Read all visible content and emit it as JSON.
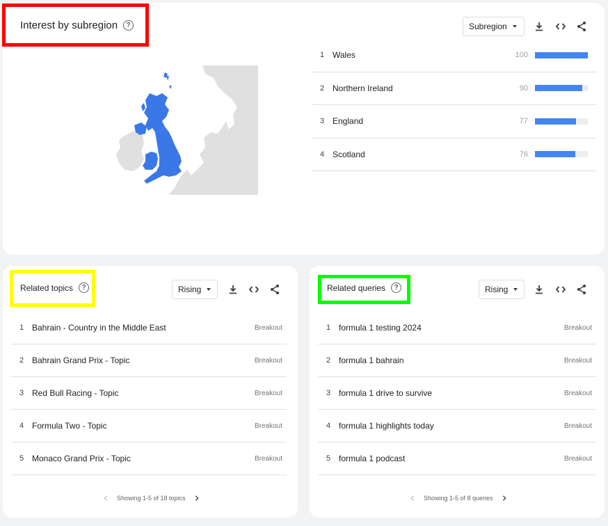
{
  "subregion": {
    "title": "Interest by subregion",
    "dropdown": "Subregion",
    "rows": [
      {
        "rank": "1",
        "name": "Wales",
        "value": "100",
        "fraction": 1.0
      },
      {
        "rank": "2",
        "name": "Northern Ireland",
        "value": "90",
        "fraction": 0.9
      },
      {
        "rank": "3",
        "name": "England",
        "value": "77",
        "fraction": 0.77
      },
      {
        "rank": "4",
        "name": "Scotland",
        "value": "76",
        "fraction": 0.76
      }
    ],
    "map_color": "#3b78e7"
  },
  "topics": {
    "title": "Related topics",
    "dropdown": "Rising",
    "rows": [
      {
        "rank": "1",
        "name": "Bahrain - Country in the Middle East",
        "badge": "Breakout"
      },
      {
        "rank": "2",
        "name": "Bahrain Grand Prix - Topic",
        "badge": "Breakout"
      },
      {
        "rank": "3",
        "name": "Red Bull Racing - Topic",
        "badge": "Breakout"
      },
      {
        "rank": "4",
        "name": "Formula Two - Topic",
        "badge": "Breakout"
      },
      {
        "rank": "5",
        "name": "Monaco Grand Prix - Topic",
        "badge": "Breakout"
      }
    ],
    "pager": "Showing 1-5 of 18 topics"
  },
  "queries": {
    "title": "Related queries",
    "dropdown": "Rising",
    "rows": [
      {
        "rank": "1",
        "name": "formula 1 testing 2024",
        "badge": "Breakout"
      },
      {
        "rank": "2",
        "name": "formula 1 bahrain",
        "badge": "Breakout"
      },
      {
        "rank": "3",
        "name": "formula 1 drive to survive",
        "badge": "Breakout"
      },
      {
        "rank": "4",
        "name": "formula 1 highlights today",
        "badge": "Breakout"
      },
      {
        "rank": "5",
        "name": "formula 1 podcast",
        "badge": "Breakout"
      }
    ],
    "pager": "Showing 1-5 of 8 queries"
  },
  "icons": {
    "help": "help-icon",
    "download": "download-icon",
    "embed": "embed-icon",
    "share": "share-icon",
    "prev": "chevron-left-icon",
    "next": "chevron-right-icon"
  },
  "colors": {
    "bar": "#4285f4",
    "highlight_subregion": "#ff0000",
    "highlight_topics": "#ffff00",
    "highlight_queries": "#00ff00"
  }
}
